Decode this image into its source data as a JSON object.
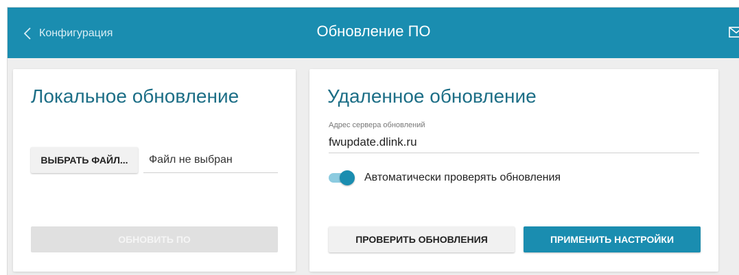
{
  "header": {
    "back_label": "Конфигурация",
    "title": "Обновление ПО",
    "icons": [
      "chevron-left-icon",
      "mail-icon"
    ]
  },
  "local_update": {
    "title": "Локальное обновление",
    "choose_file_label": "ВЫБРАТЬ ФАЙЛ...",
    "file_status": "Файл не выбран",
    "update_button_label": "ОБНОВИТЬ ПО",
    "update_button_enabled": false
  },
  "remote_update": {
    "title": "Удаленное обновление",
    "server_field_label": "Адрес сервера обновлений",
    "server_field_value": "fwupdate.dlink.ru",
    "auto_check_label": "Автоматически проверять обновления",
    "auto_check_enabled": true,
    "check_button_label": "ПРОВЕРИТЬ ОБНОВЛЕНИЯ",
    "apply_button_label": "ПРИМЕНИТЬ НАСТРОЙКИ"
  },
  "colors": {
    "header_bg": "#1a8db0",
    "title_text": "#1c6e86",
    "accent": "#1a8db0",
    "page_bg": "#eeeeee"
  }
}
